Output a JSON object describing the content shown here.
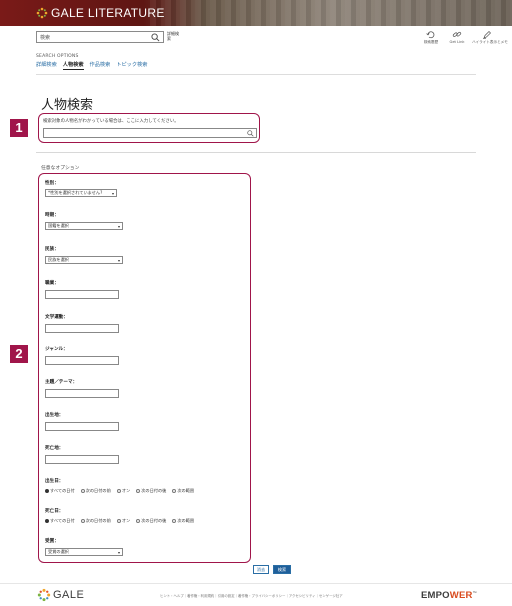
{
  "header": {
    "brand": "GALE LITERATURE"
  },
  "toolbar": {
    "search_value": "検索",
    "advanced_link": "詳細検索",
    "tools": [
      {
        "label": "検索履歴",
        "icon": "history-icon"
      },
      {
        "label": "Get Link",
        "icon": "link-icon"
      },
      {
        "label": "ハイライト表示とメモ",
        "icon": "highlighter-icon"
      }
    ]
  },
  "search_options": {
    "title": "SEARCH OPTIONS",
    "tabs": [
      "詳細検索",
      "人物検索",
      "作品検索",
      "トピック検索"
    ],
    "active_tab": "人物検索"
  },
  "page": {
    "title": "人物検索",
    "hint": "検索対象の人物名がわかっている場合は、ここに入力してください。",
    "name_value": "",
    "optional_title": "任意なオプション"
  },
  "callouts": [
    "1",
    "2"
  ],
  "fields": {
    "gender": {
      "label": "性別：",
      "value": "*性別を選択されていません?"
    },
    "era": {
      "label": "時期：",
      "value": "国籍を選択"
    },
    "nationality": {
      "label": "民族：",
      "value": "民族を選択"
    },
    "occupation": {
      "label": "職業："
    },
    "movement": {
      "label": "文学運動："
    },
    "genre": {
      "label": "ジャンル："
    },
    "theme": {
      "label": "主題／テーマ："
    },
    "birthplace": {
      "label": "出生地："
    },
    "deathplace": {
      "label": "死亡地："
    },
    "birth_date": {
      "label": "出生日：",
      "options": [
        "すべての日付",
        "次の日付の前",
        "オン",
        "次の日付の後",
        "次の範囲"
      ],
      "selected": 0
    },
    "death_date": {
      "label": "死亡日：",
      "options": [
        "すべての日付",
        "次の日付の前",
        "オン",
        "次の日付の後",
        "次の範囲"
      ],
      "selected": 0
    },
    "award": {
      "label": "受賞：",
      "value": "受賞の選択"
    }
  },
  "buttons": {
    "clear": "消去",
    "search": "検索"
  },
  "footer": {
    "logo": "GALE",
    "links": "ヒント・ヘルプ｜著作権・利用規約｜引用の設定｜著作権・プライバシーポリシー｜アクセシビリティ｜センゲージ社ア",
    "empower_a": "EMPO",
    "empower_b": "WER",
    "empower_tm": "™"
  },
  "colors": {
    "accent": "#a0154a",
    "link": "#2a6ea5",
    "banner": "#6a1a16",
    "button": "#1f5f9a"
  }
}
